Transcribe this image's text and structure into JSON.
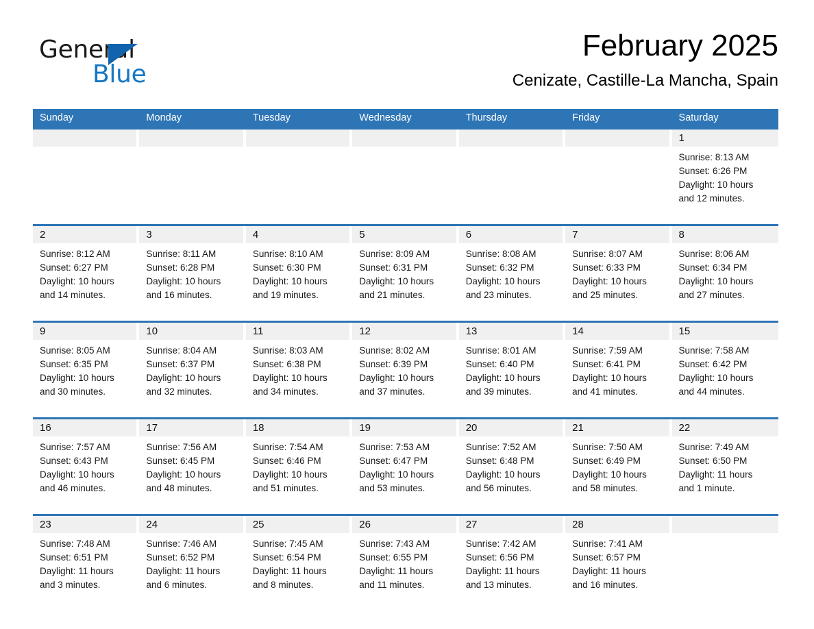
{
  "brand": {
    "name_part1": "General",
    "name_part2": "Blue",
    "triangle_color": "#1263ad",
    "blue_color": "#1577c4"
  },
  "header": {
    "month_title": "February 2025",
    "location": "Cenizate, Castille-La Mancha, Spain",
    "header_bg": "#2e75b6",
    "day_header_bg": "#f0f0f0"
  },
  "weekdays": [
    "Sunday",
    "Monday",
    "Tuesday",
    "Wednesday",
    "Thursday",
    "Friday",
    "Saturday"
  ],
  "weeks": [
    [
      {
        "day": "",
        "sunrise": "",
        "sunset": "",
        "daylight1": "",
        "daylight2": "",
        "empty": true
      },
      {
        "day": "",
        "sunrise": "",
        "sunset": "",
        "daylight1": "",
        "daylight2": "",
        "empty": true
      },
      {
        "day": "",
        "sunrise": "",
        "sunset": "",
        "daylight1": "",
        "daylight2": "",
        "empty": true
      },
      {
        "day": "",
        "sunrise": "",
        "sunset": "",
        "daylight1": "",
        "daylight2": "",
        "empty": true
      },
      {
        "day": "",
        "sunrise": "",
        "sunset": "",
        "daylight1": "",
        "daylight2": "",
        "empty": true
      },
      {
        "day": "",
        "sunrise": "",
        "sunset": "",
        "daylight1": "",
        "daylight2": "",
        "empty": true
      },
      {
        "day": "1",
        "sunrise": "Sunrise: 8:13 AM",
        "sunset": "Sunset: 6:26 PM",
        "daylight1": "Daylight: 10 hours",
        "daylight2": "and 12 minutes.",
        "empty": false
      }
    ],
    [
      {
        "day": "2",
        "sunrise": "Sunrise: 8:12 AM",
        "sunset": "Sunset: 6:27 PM",
        "daylight1": "Daylight: 10 hours",
        "daylight2": "and 14 minutes.",
        "empty": false
      },
      {
        "day": "3",
        "sunrise": "Sunrise: 8:11 AM",
        "sunset": "Sunset: 6:28 PM",
        "daylight1": "Daylight: 10 hours",
        "daylight2": "and 16 minutes.",
        "empty": false
      },
      {
        "day": "4",
        "sunrise": "Sunrise: 8:10 AM",
        "sunset": "Sunset: 6:30 PM",
        "daylight1": "Daylight: 10 hours",
        "daylight2": "and 19 minutes.",
        "empty": false
      },
      {
        "day": "5",
        "sunrise": "Sunrise: 8:09 AM",
        "sunset": "Sunset: 6:31 PM",
        "daylight1": "Daylight: 10 hours",
        "daylight2": "and 21 minutes.",
        "empty": false
      },
      {
        "day": "6",
        "sunrise": "Sunrise: 8:08 AM",
        "sunset": "Sunset: 6:32 PM",
        "daylight1": "Daylight: 10 hours",
        "daylight2": "and 23 minutes.",
        "empty": false
      },
      {
        "day": "7",
        "sunrise": "Sunrise: 8:07 AM",
        "sunset": "Sunset: 6:33 PM",
        "daylight1": "Daylight: 10 hours",
        "daylight2": "and 25 minutes.",
        "empty": false
      },
      {
        "day": "8",
        "sunrise": "Sunrise: 8:06 AM",
        "sunset": "Sunset: 6:34 PM",
        "daylight1": "Daylight: 10 hours",
        "daylight2": "and 27 minutes.",
        "empty": false
      }
    ],
    [
      {
        "day": "9",
        "sunrise": "Sunrise: 8:05 AM",
        "sunset": "Sunset: 6:35 PM",
        "daylight1": "Daylight: 10 hours",
        "daylight2": "and 30 minutes.",
        "empty": false
      },
      {
        "day": "10",
        "sunrise": "Sunrise: 8:04 AM",
        "sunset": "Sunset: 6:37 PM",
        "daylight1": "Daylight: 10 hours",
        "daylight2": "and 32 minutes.",
        "empty": false
      },
      {
        "day": "11",
        "sunrise": "Sunrise: 8:03 AM",
        "sunset": "Sunset: 6:38 PM",
        "daylight1": "Daylight: 10 hours",
        "daylight2": "and 34 minutes.",
        "empty": false
      },
      {
        "day": "12",
        "sunrise": "Sunrise: 8:02 AM",
        "sunset": "Sunset: 6:39 PM",
        "daylight1": "Daylight: 10 hours",
        "daylight2": "and 37 minutes.",
        "empty": false
      },
      {
        "day": "13",
        "sunrise": "Sunrise: 8:01 AM",
        "sunset": "Sunset: 6:40 PM",
        "daylight1": "Daylight: 10 hours",
        "daylight2": "and 39 minutes.",
        "empty": false
      },
      {
        "day": "14",
        "sunrise": "Sunrise: 7:59 AM",
        "sunset": "Sunset: 6:41 PM",
        "daylight1": "Daylight: 10 hours",
        "daylight2": "and 41 minutes.",
        "empty": false
      },
      {
        "day": "15",
        "sunrise": "Sunrise: 7:58 AM",
        "sunset": "Sunset: 6:42 PM",
        "daylight1": "Daylight: 10 hours",
        "daylight2": "and 44 minutes.",
        "empty": false
      }
    ],
    [
      {
        "day": "16",
        "sunrise": "Sunrise: 7:57 AM",
        "sunset": "Sunset: 6:43 PM",
        "daylight1": "Daylight: 10 hours",
        "daylight2": "and 46 minutes.",
        "empty": false
      },
      {
        "day": "17",
        "sunrise": "Sunrise: 7:56 AM",
        "sunset": "Sunset: 6:45 PM",
        "daylight1": "Daylight: 10 hours",
        "daylight2": "and 48 minutes.",
        "empty": false
      },
      {
        "day": "18",
        "sunrise": "Sunrise: 7:54 AM",
        "sunset": "Sunset: 6:46 PM",
        "daylight1": "Daylight: 10 hours",
        "daylight2": "and 51 minutes.",
        "empty": false
      },
      {
        "day": "19",
        "sunrise": "Sunrise: 7:53 AM",
        "sunset": "Sunset: 6:47 PM",
        "daylight1": "Daylight: 10 hours",
        "daylight2": "and 53 minutes.",
        "empty": false
      },
      {
        "day": "20",
        "sunrise": "Sunrise: 7:52 AM",
        "sunset": "Sunset: 6:48 PM",
        "daylight1": "Daylight: 10 hours",
        "daylight2": "and 56 minutes.",
        "empty": false
      },
      {
        "day": "21",
        "sunrise": "Sunrise: 7:50 AM",
        "sunset": "Sunset: 6:49 PM",
        "daylight1": "Daylight: 10 hours",
        "daylight2": "and 58 minutes.",
        "empty": false
      },
      {
        "day": "22",
        "sunrise": "Sunrise: 7:49 AM",
        "sunset": "Sunset: 6:50 PM",
        "daylight1": "Daylight: 11 hours",
        "daylight2": "and 1 minute.",
        "empty": false
      }
    ],
    [
      {
        "day": "23",
        "sunrise": "Sunrise: 7:48 AM",
        "sunset": "Sunset: 6:51 PM",
        "daylight1": "Daylight: 11 hours",
        "daylight2": "and 3 minutes.",
        "empty": false
      },
      {
        "day": "24",
        "sunrise": "Sunrise: 7:46 AM",
        "sunset": "Sunset: 6:52 PM",
        "daylight1": "Daylight: 11 hours",
        "daylight2": "and 6 minutes.",
        "empty": false
      },
      {
        "day": "25",
        "sunrise": "Sunrise: 7:45 AM",
        "sunset": "Sunset: 6:54 PM",
        "daylight1": "Daylight: 11 hours",
        "daylight2": "and 8 minutes.",
        "empty": false
      },
      {
        "day": "26",
        "sunrise": "Sunrise: 7:43 AM",
        "sunset": "Sunset: 6:55 PM",
        "daylight1": "Daylight: 11 hours",
        "daylight2": "and 11 minutes.",
        "empty": false
      },
      {
        "day": "27",
        "sunrise": "Sunrise: 7:42 AM",
        "sunset": "Sunset: 6:56 PM",
        "daylight1": "Daylight: 11 hours",
        "daylight2": "and 13 minutes.",
        "empty": false
      },
      {
        "day": "28",
        "sunrise": "Sunrise: 7:41 AM",
        "sunset": "Sunset: 6:57 PM",
        "daylight1": "Daylight: 11 hours",
        "daylight2": "and 16 minutes.",
        "empty": false
      },
      {
        "day": "",
        "sunrise": "",
        "sunset": "",
        "daylight1": "",
        "daylight2": "",
        "empty": true
      }
    ]
  ]
}
